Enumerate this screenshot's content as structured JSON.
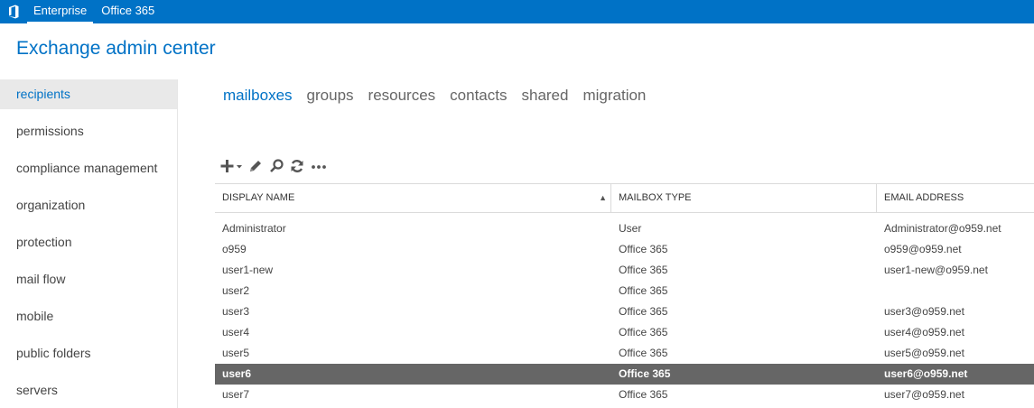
{
  "topbar": {
    "items": [
      {
        "label": "Enterprise",
        "active": true
      },
      {
        "label": "Office 365",
        "active": false
      }
    ],
    "logo_icon": "office-logo-icon",
    "background": "#0072c6"
  },
  "app_title": "Exchange admin center",
  "sidebar": {
    "items": [
      {
        "label": "recipients",
        "active": true
      },
      {
        "label": "permissions"
      },
      {
        "label": "compliance management"
      },
      {
        "label": "organization"
      },
      {
        "label": "protection"
      },
      {
        "label": "mail flow"
      },
      {
        "label": "mobile"
      },
      {
        "label": "public folders"
      },
      {
        "label": "servers"
      }
    ]
  },
  "tabs": [
    {
      "label": "mailboxes",
      "active": true
    },
    {
      "label": "groups"
    },
    {
      "label": "resources"
    },
    {
      "label": "contacts"
    },
    {
      "label": "shared"
    },
    {
      "label": "migration"
    }
  ],
  "toolbar": {
    "icons": [
      "add-dropdown-icon",
      "edit-icon",
      "search-icon",
      "refresh-icon",
      "more-icon"
    ]
  },
  "table": {
    "columns": [
      "DISPLAY NAME",
      "MAILBOX TYPE",
      "EMAIL ADDRESS"
    ],
    "sorted_column": 0,
    "rows": [
      {
        "name": "Administrator",
        "type": "User",
        "email": "Administrator@o959.net"
      },
      {
        "name": "o959",
        "type": "Office 365",
        "email": "o959@o959.net"
      },
      {
        "name": "user1-new",
        "type": "Office 365",
        "email": "user1-new@o959.net"
      },
      {
        "name": "user2",
        "type": "Office 365",
        "email": ""
      },
      {
        "name": "user3",
        "type": "Office 365",
        "email": "user3@o959.net"
      },
      {
        "name": "user4",
        "type": "Office 365",
        "email": "user4@o959.net"
      },
      {
        "name": "user5",
        "type": "Office 365",
        "email": "user5@o959.net"
      },
      {
        "name": "user6",
        "type": "Office 365",
        "email": "user6@o959.net",
        "selected": true
      },
      {
        "name": "user7",
        "type": "Office 365",
        "email": "user7@o959.net"
      }
    ]
  },
  "colors": {
    "accent": "#0072c6",
    "selected_row": "#666666"
  }
}
